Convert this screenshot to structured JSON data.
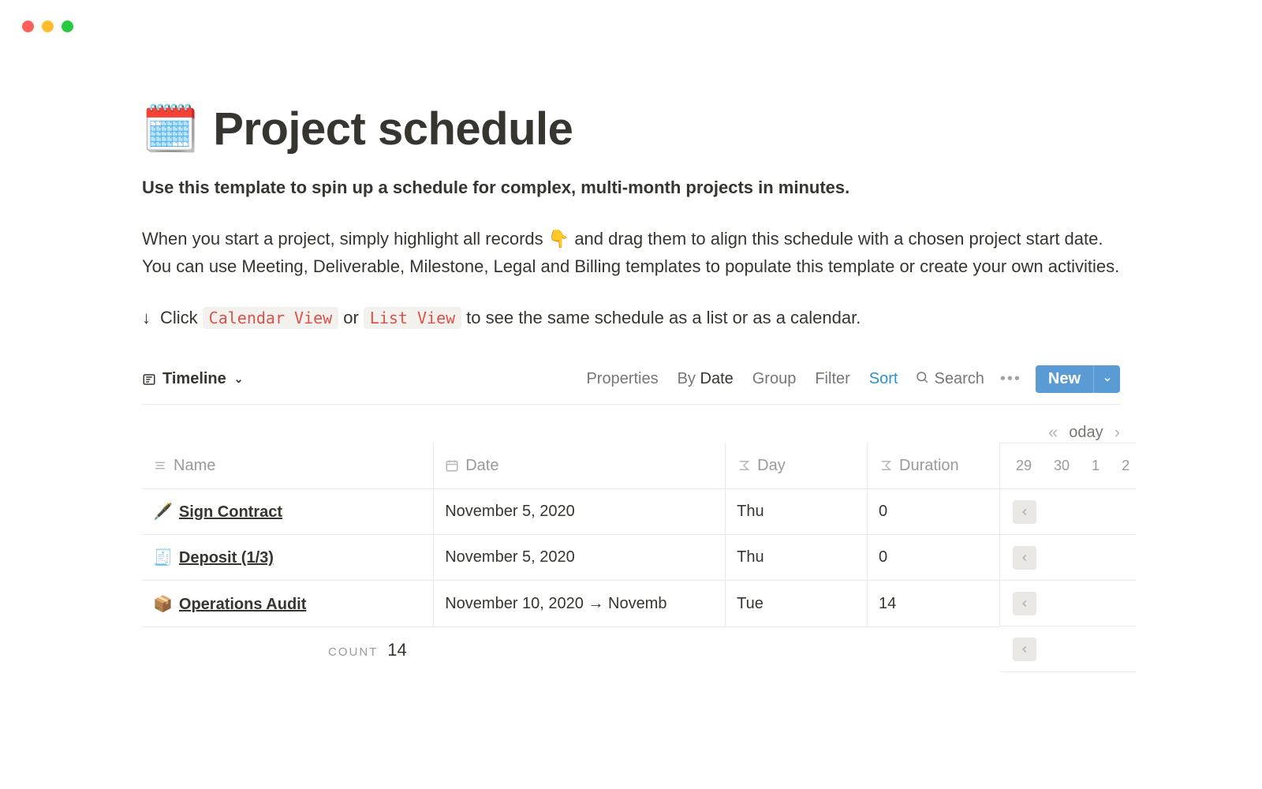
{
  "window": {
    "platform": "mac"
  },
  "header": {
    "icon": "🗓️",
    "title": "Project schedule",
    "subtitle": "Use this template to spin up a schedule for complex, multi-month projects in minutes.",
    "body_pre": "When you start a project, simply highlight all records ",
    "body_emoji": "👇",
    "body_post": " and drag them to align this schedule with a chosen project start date. You can use Meeting, Deliverable, Milestone, Legal and Billing templates to populate this template or create your own activities.",
    "hint_arrow": "↓",
    "hint_click": "Click",
    "hint_cal": "Calendar View",
    "hint_or": "or",
    "hint_list": "List View",
    "hint_tail": "to see the same schedule as a list or as a calendar."
  },
  "toolbar": {
    "view_label": "Timeline",
    "properties": "Properties",
    "by": "By",
    "by_field": "Date",
    "group": "Group",
    "filter": "Filter",
    "sort": "Sort",
    "search": "Search",
    "new": "New"
  },
  "timeline_nav": {
    "today": "oday",
    "days": [
      "29",
      "30",
      "1",
      "2"
    ]
  },
  "columns": {
    "name": "Name",
    "date": "Date",
    "day": "Day",
    "duration": "Duration"
  },
  "rows": [
    {
      "icon": "🖋️",
      "name": "Sign Contract",
      "date": "November 5, 2020",
      "day": "Thu",
      "duration": "0"
    },
    {
      "icon": "🧾",
      "name": "Deposit (1/3)",
      "date": "November 5, 2020",
      "day": "Thu",
      "duration": "0"
    },
    {
      "icon": "📦",
      "name": "Operations Audit",
      "date": "November 10, 2020 → Novemb",
      "day": "Tue",
      "duration": "14"
    }
  ],
  "footer": {
    "count_label": "COUNT",
    "count_value": "14"
  }
}
